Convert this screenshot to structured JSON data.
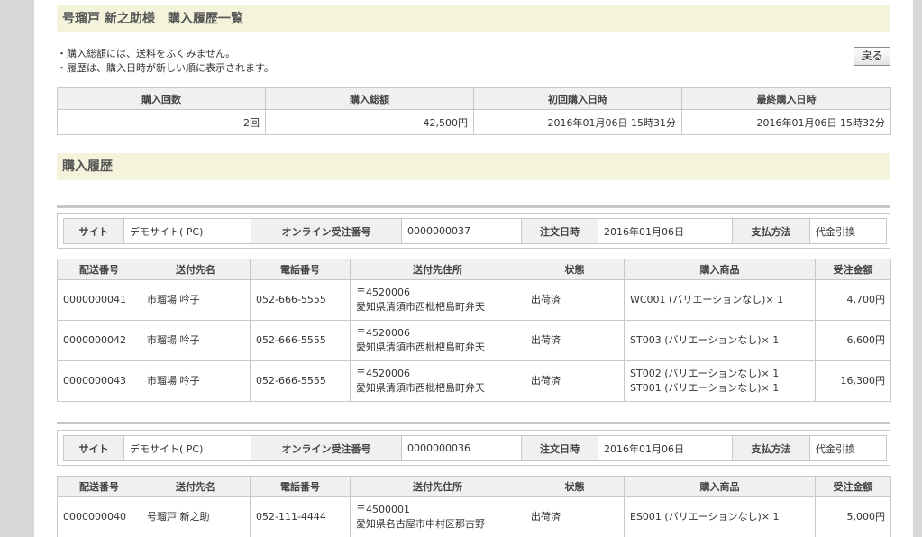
{
  "page_title": "号瑠戸 新之助様　購入履歴一覧",
  "notes": [
    "・購入総額には、送料をふくみません。",
    "・履歴は、購入日時が新しい順に表示されます。"
  ],
  "back_button": "戻る",
  "summary": {
    "headers": [
      "購入回数",
      "購入総額",
      "初回購入日時",
      "最終購入日時"
    ],
    "values": [
      "2回",
      "42,500円",
      "2016年01月06日 15時31分",
      "2016年01月06日 15時32分"
    ]
  },
  "history_title": "購入履歴",
  "order_labels": {
    "site": "サイト",
    "order_no": "オンライン受注番号",
    "order_date": "注文日時",
    "payment": "支払方法"
  },
  "shipment_headers": [
    "配送番号",
    "送付先名",
    "電話番号",
    "送付先住所",
    "状態",
    "購入商品",
    "受注金額"
  ],
  "orders": [
    {
      "site": "デモサイト( PC)",
      "order_no": "0000000037",
      "order_date": "2016年01月06日",
      "payment": "代金引換",
      "shipments": [
        {
          "no": "0000000041",
          "name": "市瑠場 吟子",
          "phone": "052-666-5555",
          "zip": "〒4520006",
          "address": "愛知県清須市西枇杷島町弁天",
          "status": "出荷済",
          "items": [
            "WC001 (バリエーションなし)× 1"
          ],
          "amount": "4,700円"
        },
        {
          "no": "0000000042",
          "name": "市瑠場 吟子",
          "phone": "052-666-5555",
          "zip": "〒4520006",
          "address": "愛知県清須市西枇杷島町弁天",
          "status": "出荷済",
          "items": [
            "ST003 (バリエーションなし)× 1"
          ],
          "amount": "6,600円"
        },
        {
          "no": "0000000043",
          "name": "市瑠場 吟子",
          "phone": "052-666-5555",
          "zip": "〒4520006",
          "address": "愛知県清須市西枇杷島町弁天",
          "status": "出荷済",
          "items": [
            "ST002 (バリエーションなし)× 1",
            "ST001 (バリエーションなし)× 1"
          ],
          "amount": "16,300円"
        }
      ]
    },
    {
      "site": "デモサイト( PC)",
      "order_no": "0000000036",
      "order_date": "2016年01月06日",
      "payment": "代金引換",
      "shipments": [
        {
          "no": "0000000040",
          "name": "号瑠戸 新之助",
          "phone": "052-111-4444",
          "zip": "〒4500001",
          "address": "愛知県名古屋市中村区那古野",
          "status": "出荷済",
          "items": [
            "ES001 (バリエーションなし)× 1"
          ],
          "amount": "5,000円"
        }
      ]
    }
  ]
}
